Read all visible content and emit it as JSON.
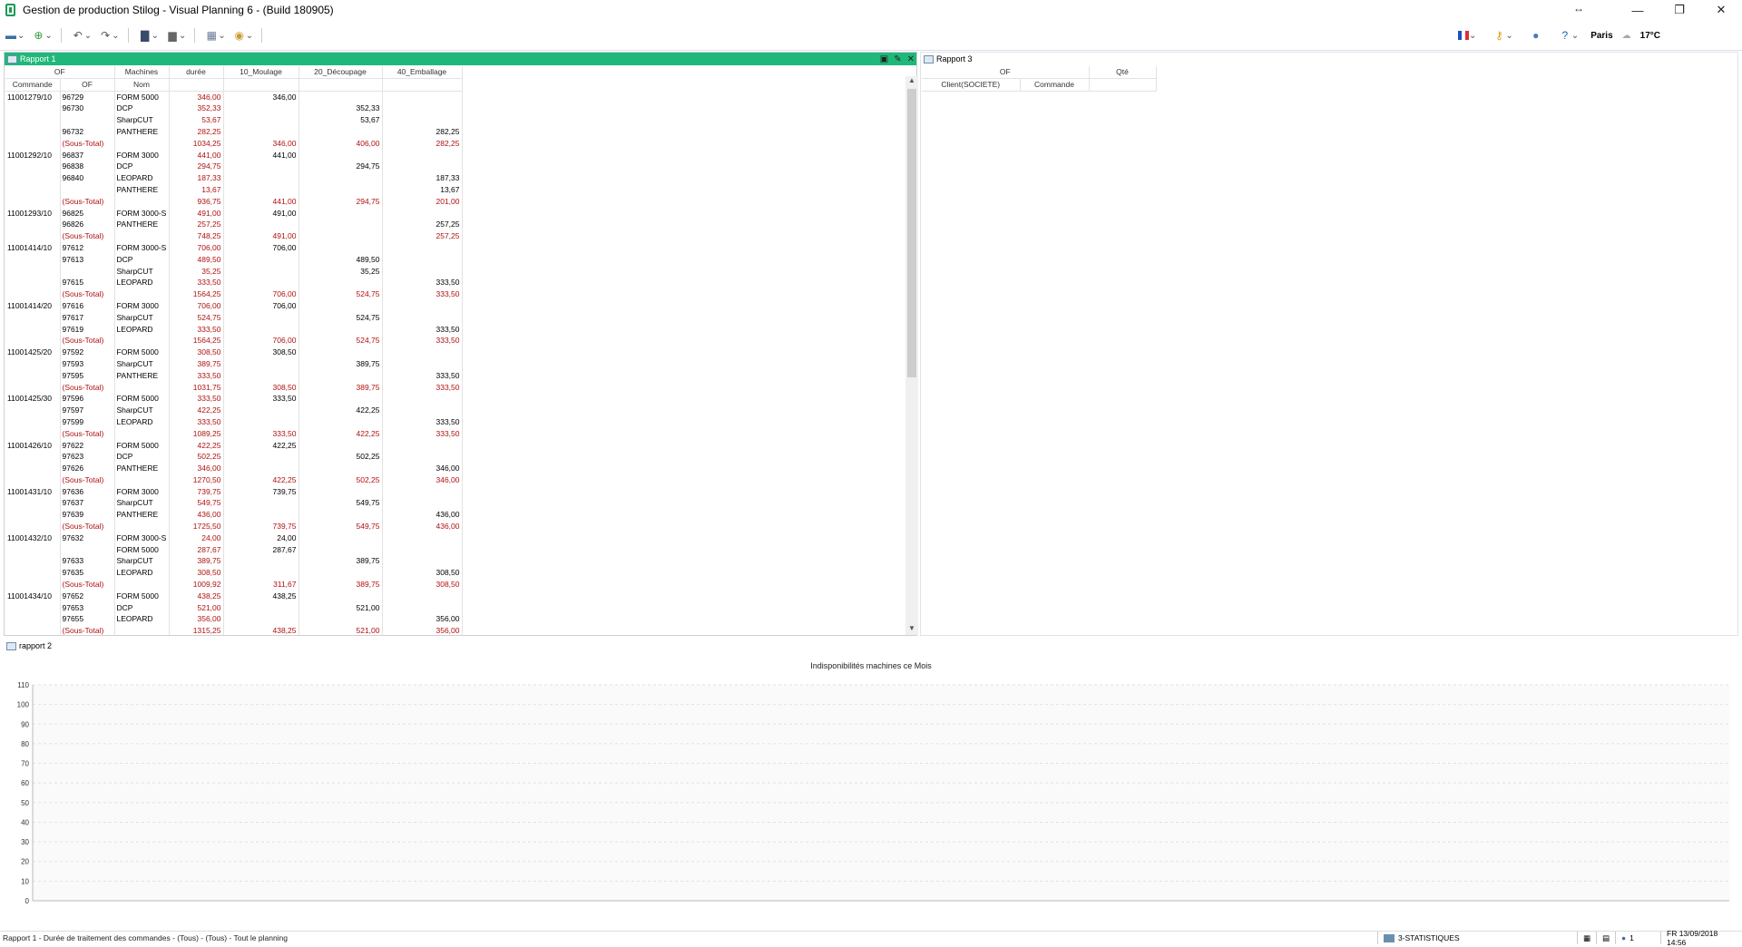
{
  "app": {
    "title": "Gestion de production Stilog - Visual Planning 6 - (Build 180905)"
  },
  "window_controls": {
    "resize": "↔",
    "minimize": "—",
    "restore": "❐",
    "close": "✕"
  },
  "toolbar": {
    "location": "Paris",
    "temperature": "17°C",
    "colors": {
      "flag_blue": "#1f4fbf",
      "flag_white": "#ffffff",
      "flag_red": "#e03030"
    }
  },
  "rapport1": {
    "title": "Rapport 1",
    "header_color": "#20b87a",
    "headers_top": [
      "OF",
      "Machines",
      "durée",
      "10_Moulage",
      "20_Découpage",
      "40_Emballage"
    ],
    "headers_sub": [
      "Commande",
      "OF",
      "Nom"
    ],
    "rows": [
      [
        "11001279/10",
        "96729",
        "FORM 5000",
        "346,00",
        "346,00",
        "",
        ""
      ],
      [
        "",
        "96730",
        "DCP",
        "352,33",
        "",
        "352,33",
        ""
      ],
      [
        "",
        "",
        "SharpCUT",
        "53,67",
        "",
        "53,67",
        ""
      ],
      [
        "",
        "96732",
        "PANTHERE",
        "282,25",
        "",
        "",
        "282,25"
      ],
      [
        "",
        "(Sous-Total)",
        "",
        "1034,25",
        "346,00",
        "406,00",
        "282,25"
      ],
      [
        "11001292/10",
        "96837",
        "FORM 3000",
        "441,00",
        "441,00",
        "",
        ""
      ],
      [
        "",
        "96838",
        "DCP",
        "294,75",
        "",
        "294,75",
        ""
      ],
      [
        "",
        "96840",
        "LEOPARD",
        "187,33",
        "",
        "",
        "187,33"
      ],
      [
        "",
        "",
        "PANTHERE",
        "13,67",
        "",
        "",
        "13,67"
      ],
      [
        "",
        "(Sous-Total)",
        "",
        "936,75",
        "441,00",
        "294,75",
        "201,00"
      ],
      [
        "11001293/10",
        "96825",
        "FORM 3000-S",
        "491,00",
        "491,00",
        "",
        ""
      ],
      [
        "",
        "96826",
        "PANTHERE",
        "257,25",
        "",
        "",
        "257,25"
      ],
      [
        "",
        "(Sous-Total)",
        "",
        "748,25",
        "491,00",
        "",
        "257,25"
      ],
      [
        "11001414/10",
        "97612",
        "FORM 3000-S",
        "706,00",
        "706,00",
        "",
        ""
      ],
      [
        "",
        "97613",
        "DCP",
        "489,50",
        "",
        "489,50",
        ""
      ],
      [
        "",
        "",
        "SharpCUT",
        "35,25",
        "",
        "35,25",
        ""
      ],
      [
        "",
        "97615",
        "LEOPARD",
        "333,50",
        "",
        "",
        "333,50"
      ],
      [
        "",
        "(Sous-Total)",
        "",
        "1564,25",
        "706,00",
        "524,75",
        "333,50"
      ],
      [
        "11001414/20",
        "97616",
        "FORM 3000",
        "706,00",
        "706,00",
        "",
        ""
      ],
      [
        "",
        "97617",
        "SharpCUT",
        "524,75",
        "",
        "524,75",
        ""
      ],
      [
        "",
        "97619",
        "LEOPARD",
        "333,50",
        "",
        "",
        "333,50"
      ],
      [
        "",
        "(Sous-Total)",
        "",
        "1564,25",
        "706,00",
        "524,75",
        "333,50"
      ],
      [
        "11001425/20",
        "97592",
        "FORM 5000",
        "308,50",
        "308,50",
        "",
        ""
      ],
      [
        "",
        "97593",
        "SharpCUT",
        "389,75",
        "",
        "389,75",
        ""
      ],
      [
        "",
        "97595",
        "PANTHERE",
        "333,50",
        "",
        "",
        "333,50"
      ],
      [
        "",
        "(Sous-Total)",
        "",
        "1031,75",
        "308,50",
        "389,75",
        "333,50"
      ],
      [
        "11001425/30",
        "97596",
        "FORM 5000",
        "333,50",
        "333,50",
        "",
        ""
      ],
      [
        "",
        "97597",
        "SharpCUT",
        "422,25",
        "",
        "422,25",
        ""
      ],
      [
        "",
        "97599",
        "LEOPARD",
        "333,50",
        "",
        "",
        "333,50"
      ],
      [
        "",
        "(Sous-Total)",
        "",
        "1089,25",
        "333,50",
        "422,25",
        "333,50"
      ],
      [
        "11001426/10",
        "97622",
        "FORM 5000",
        "422,25",
        "422,25",
        "",
        ""
      ],
      [
        "",
        "97623",
        "DCP",
        "502,25",
        "",
        "502,25",
        ""
      ],
      [
        "",
        "97626",
        "PANTHERE",
        "346,00",
        "",
        "",
        "346,00"
      ],
      [
        "",
        "(Sous-Total)",
        "",
        "1270,50",
        "422,25",
        "502,25",
        "346,00"
      ],
      [
        "11001431/10",
        "97636",
        "FORM 3000",
        "739,75",
        "739,75",
        "",
        ""
      ],
      [
        "",
        "97637",
        "SharpCUT",
        "549,75",
        "",
        "549,75",
        ""
      ],
      [
        "",
        "97639",
        "PANTHERE",
        "436,00",
        "",
        "",
        "436,00"
      ],
      [
        "",
        "(Sous-Total)",
        "",
        "1725,50",
        "739,75",
        "549,75",
        "436,00"
      ],
      [
        "11001432/10",
        "97632",
        "FORM 3000-S",
        "24,00",
        "24,00",
        "",
        ""
      ],
      [
        "",
        "",
        "FORM 5000",
        "287,67",
        "287,67",
        "",
        ""
      ],
      [
        "",
        "97633",
        "SharpCUT",
        "389,75",
        "",
        "389,75",
        ""
      ],
      [
        "",
        "97635",
        "LEOPARD",
        "308,50",
        "",
        "",
        "308,50"
      ],
      [
        "",
        "(Sous-Total)",
        "",
        "1009,92",
        "311,67",
        "389,75",
        "308,50"
      ],
      [
        "11001434/10",
        "97652",
        "FORM 5000",
        "438,25",
        "438,25",
        "",
        ""
      ],
      [
        "",
        "97653",
        "DCP",
        "521,00",
        "",
        "521,00",
        ""
      ],
      [
        "",
        "97655",
        "LEOPARD",
        "356,00",
        "",
        "",
        "356,00"
      ],
      [
        "",
        "(Sous-Total)",
        "",
        "1315,25",
        "438,25",
        "521,00",
        "356,00"
      ]
    ]
  },
  "rapport3": {
    "title": "Rapport 3",
    "headers_top": [
      "OF",
      "Qté"
    ],
    "headers_sub": [
      "Client(SOCIETE)",
      "Commande"
    ]
  },
  "rapport2": {
    "title": "rapport 2",
    "chart_data": {
      "type": "bar",
      "title": "Indisponibilités machines ce Mois",
      "categories": [],
      "values": [],
      "ylim": [
        0,
        110
      ],
      "yticks": [
        "0",
        "10",
        "20",
        "30",
        "40",
        "50",
        "60",
        "70",
        "80",
        "90",
        "100",
        "110"
      ],
      "grid": true
    }
  },
  "statusbar": {
    "text": "Rapport 1 - Durée de traitement des commandes - (Tous) - (Tous) - Tout le planning",
    "view": "3-STATISTIQUES",
    "users": "1",
    "datetime": "FR 13/09/2018 14:56"
  }
}
